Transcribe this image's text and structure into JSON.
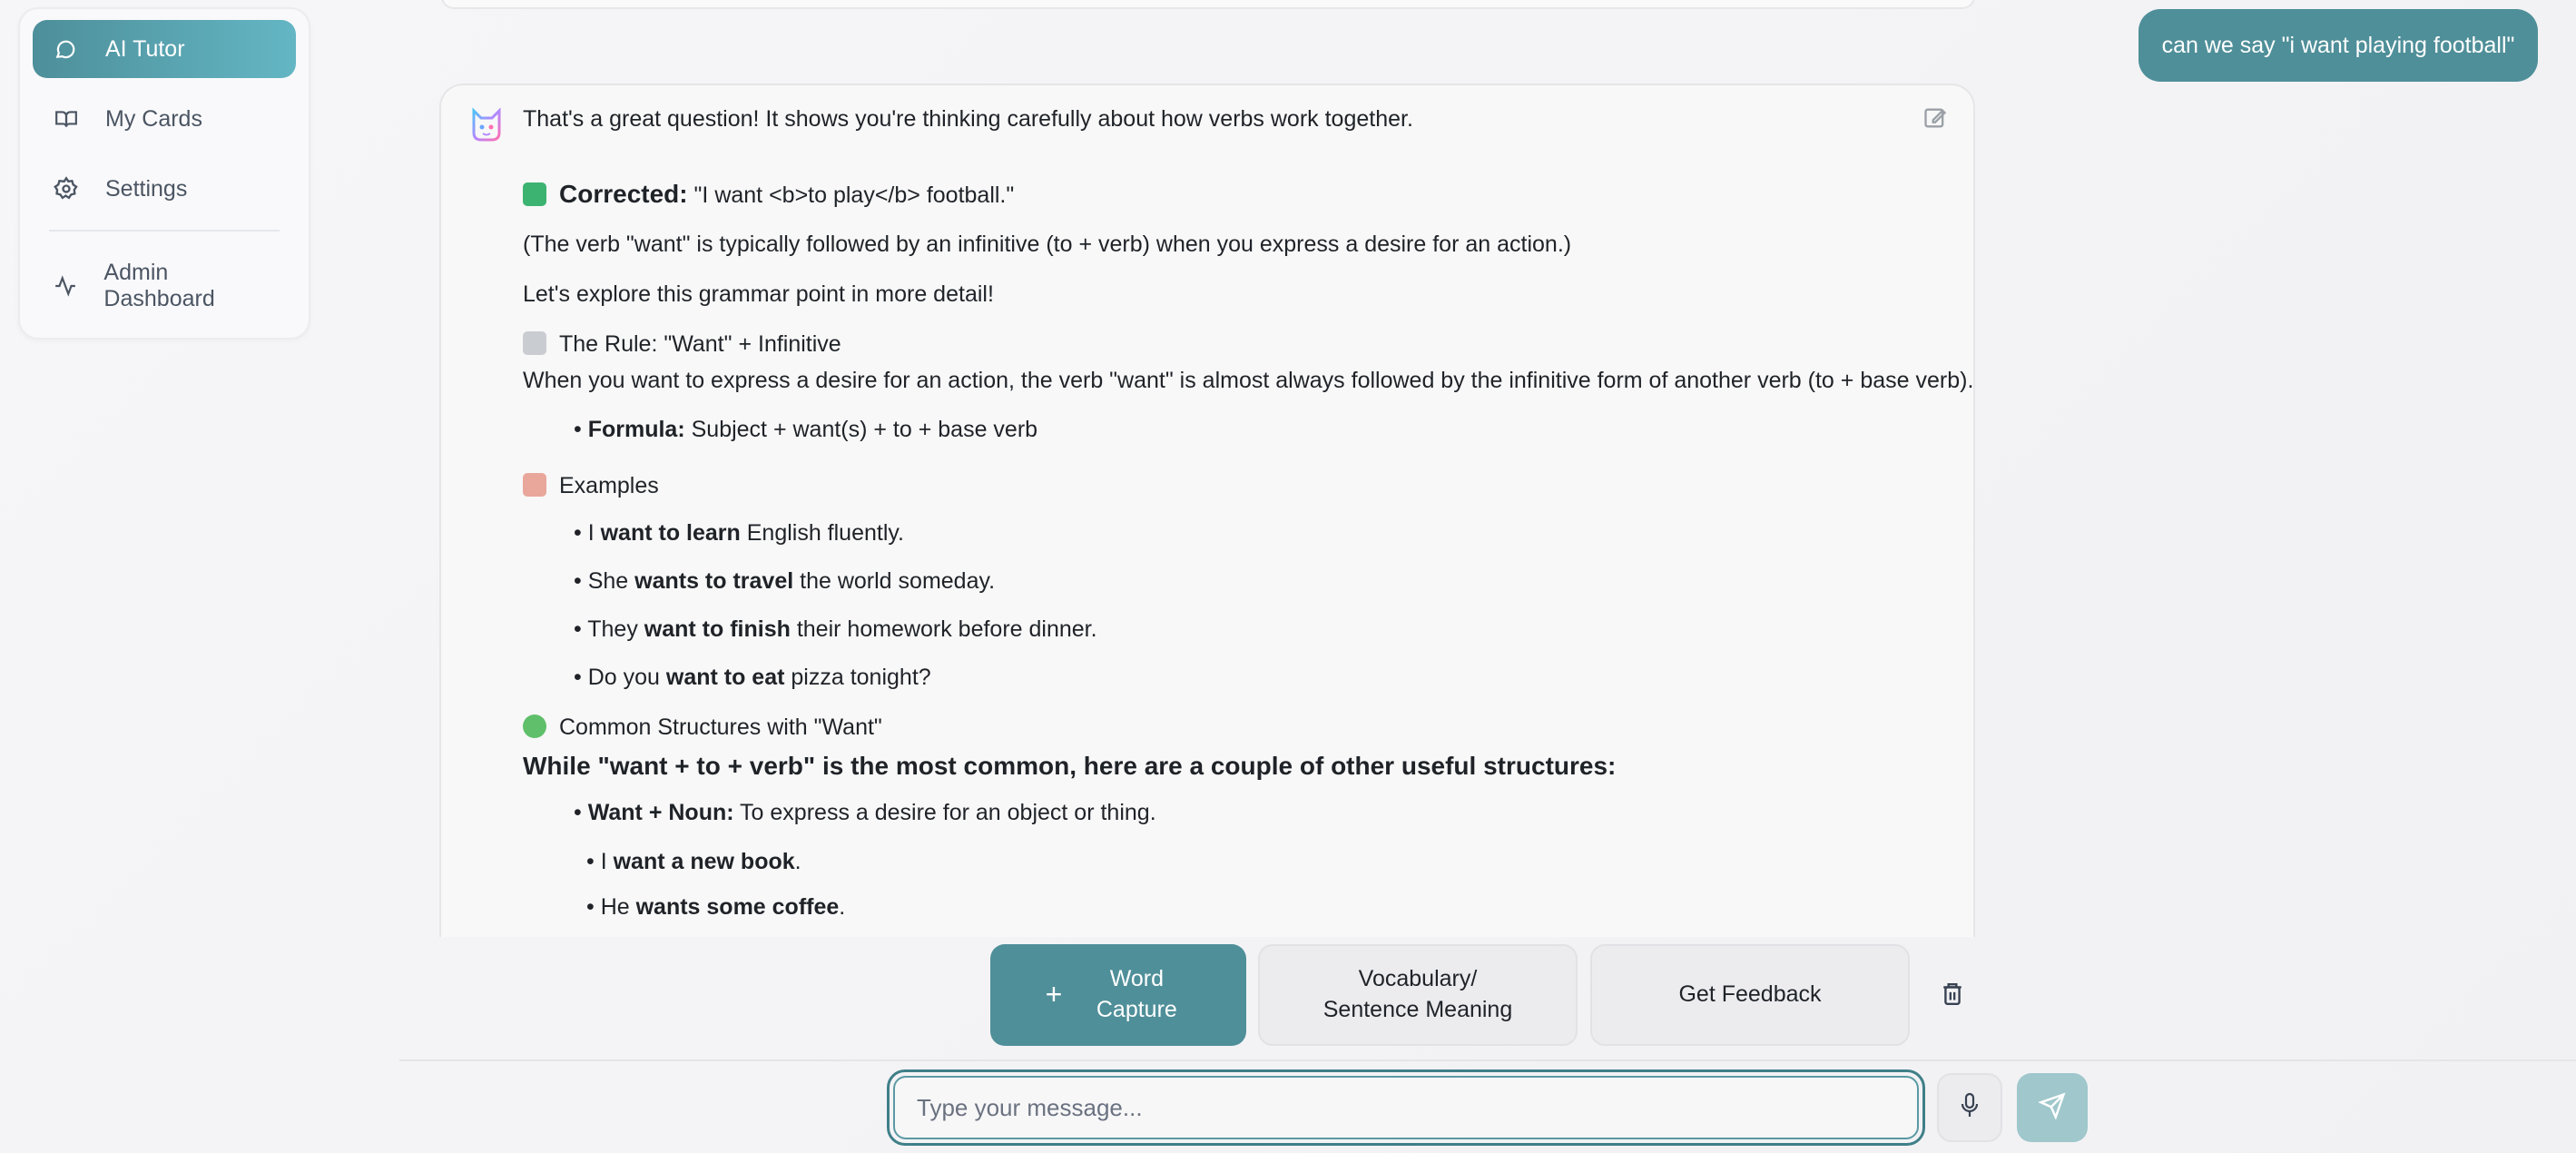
{
  "sidebar": {
    "items": [
      {
        "label": "AI Tutor",
        "icon": "chat-bubble-icon",
        "active": true
      },
      {
        "label": "My Cards",
        "icon": "book-icon",
        "active": false
      },
      {
        "label": "Settings",
        "icon": "gear-icon",
        "active": false
      },
      {
        "label": "Admin Dashboard",
        "icon": "activity-icon",
        "active": false
      }
    ]
  },
  "chat": {
    "user_message": "can we say \"i want playing football\"",
    "answer": {
      "intro": "That's a great question! It shows you're thinking carefully about how verbs work together.",
      "corrected_label": "Corrected:",
      "corrected_text": "\"I want <b>to play</b> football.\"",
      "explanation": "(The verb \"want\" is typically followed by an infinitive (to + verb) when you express a desire for an action.)",
      "explore": "Let's explore this grammar point in more detail!",
      "rule_heading": "The Rule: \"Want\" + Infinitive",
      "rule_text": "When you want to express a desire for an action, the verb \"want\" is almost always followed by the infinitive form of another verb (to + base verb).",
      "formula_label": "Formula:",
      "formula_text": "Subject + want(s) + to + base verb",
      "examples_heading": "Examples",
      "examples": [
        {
          "pre": "I ",
          "bold": "want to learn",
          "post": " English fluently."
        },
        {
          "pre": "She ",
          "bold": "wants to travel",
          "post": " the world someday."
        },
        {
          "pre": "They ",
          "bold": "want to finish",
          "post": " their homework before dinner."
        },
        {
          "pre": "Do you ",
          "bold": "want to eat",
          "post": " pizza tonight?"
        }
      ],
      "structures_heading": "Common Structures with \"Want\"",
      "structures_intro": "While \"want + to + verb\" is the most common, here are a couple of other useful structures:",
      "noun_label": "Want + Noun:",
      "noun_text": " To express a desire for an object or thing.",
      "noun_examples": [
        {
          "pre": "I ",
          "bold": "want a new book",
          "post": "."
        },
        {
          "pre": "He ",
          "bold": "wants some coffee",
          "post": "."
        }
      ]
    }
  },
  "actions": {
    "word_capture": "Word Capture",
    "vocab_meaning": "Vocabulary/ Sentence Meaning",
    "get_feedback": "Get Feedback"
  },
  "composer": {
    "placeholder": "Type your message..."
  },
  "colors": {
    "accent": "#4f8f99",
    "accent_light": "#64b6c4",
    "send_disabled": "#9fc7cc"
  }
}
